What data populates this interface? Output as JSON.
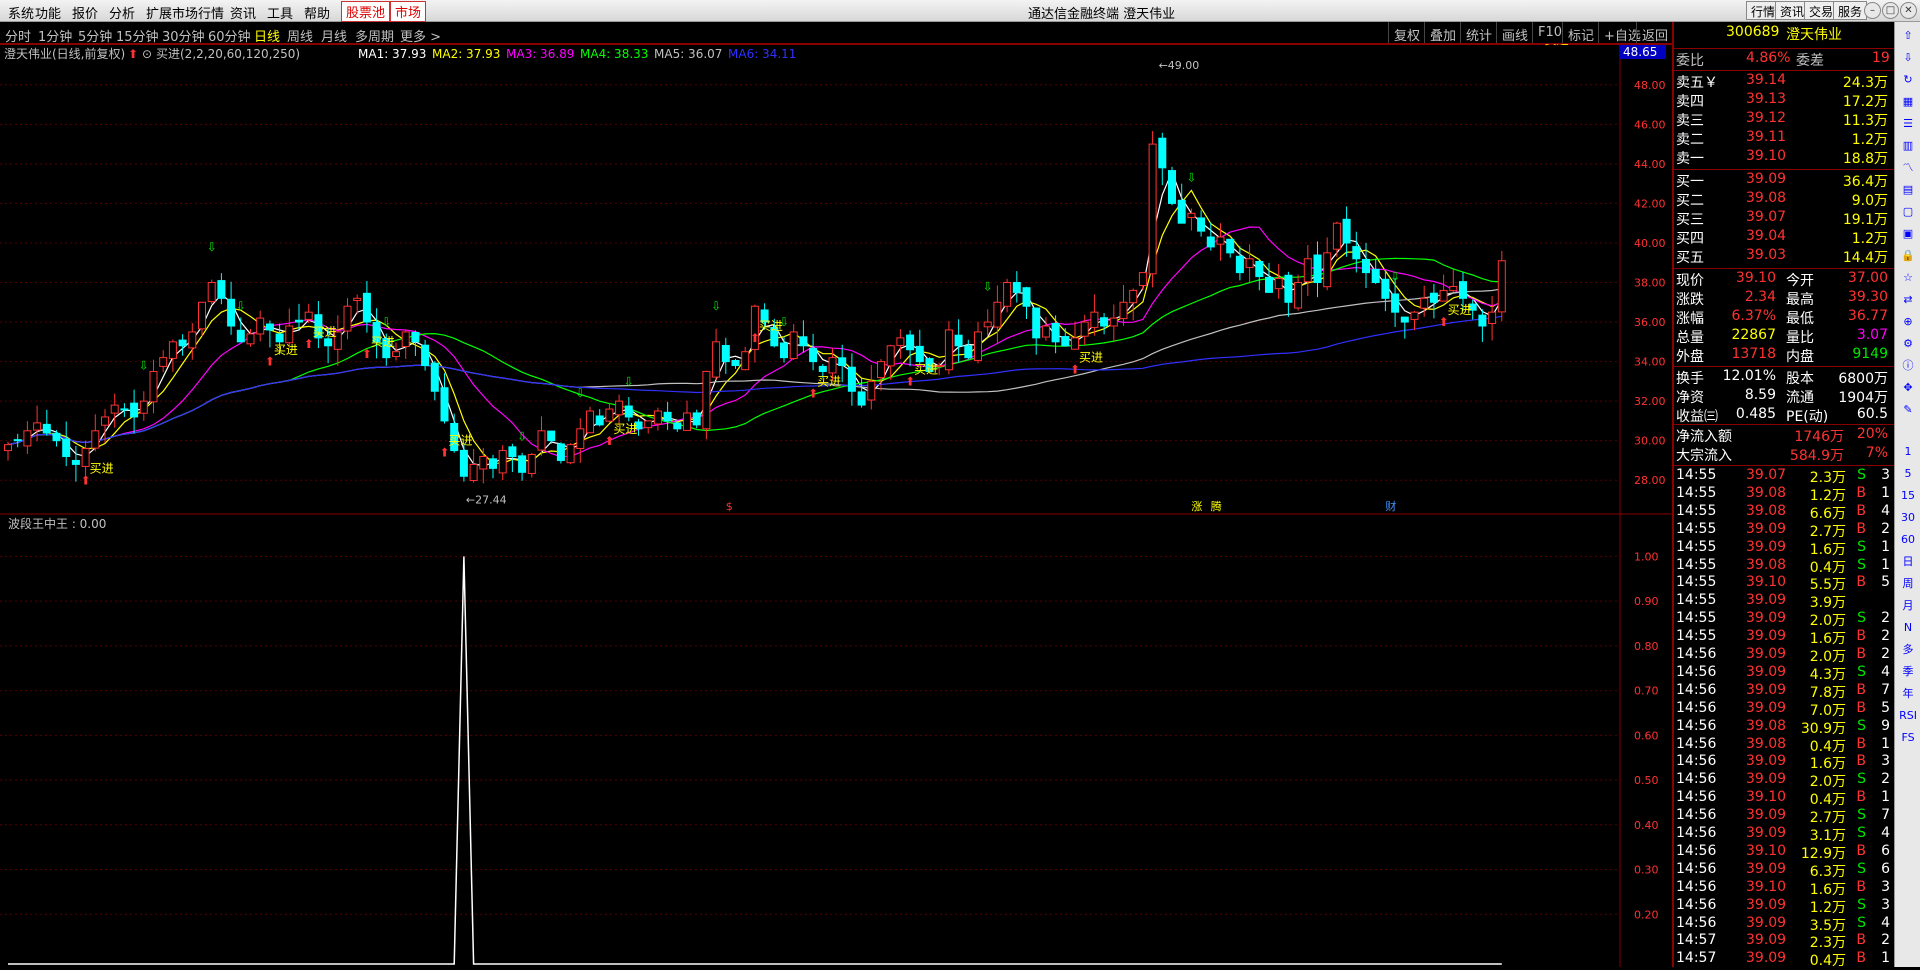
{
  "menu": [
    "系统",
    "功能",
    "报价",
    "分析",
    "扩展市场行情",
    "资讯",
    "工具",
    "帮助",
    "股票池",
    "市场"
  ],
  "window_title": "通达信金融终端  澄天伟业",
  "top_right_buttons": [
    "行情",
    "资讯",
    "交易",
    "服务"
  ],
  "period_tabs": [
    "分时",
    "1分钟",
    "5分钟",
    "15分钟",
    "30分钟",
    "60分钟",
    "日线",
    "周线",
    "月线",
    "多周期",
    "更多 >"
  ],
  "active_period": "日线",
  "chart_toolbar": [
    "复权",
    "叠加",
    "统计",
    "画线",
    "F10",
    "标记",
    "+自选",
    "返回"
  ],
  "main_chart": {
    "stock_label": "澄天伟业(日线,前复权)",
    "indicator_name": "买进(2,2,20,60,120,250)",
    "ma": [
      {
        "label": "MA1: 37.93",
        "color": "#ffffff"
      },
      {
        "label": "MA2: 37.93",
        "color": "#ffff00"
      },
      {
        "label": "MA3: 36.89",
        "color": "#ff00ff"
      },
      {
        "label": "MA4: 38.33",
        "color": "#00ff00"
      },
      {
        "label": "MA5: 36.07",
        "color": "#c0c0c0"
      },
      {
        "label": "MA6: 34.11",
        "color": "#3030ff"
      }
    ],
    "y_ticks": [
      "48.00",
      "46.00",
      "44.00",
      "42.00",
      "40.00",
      "38.00",
      "36.00",
      "34.00",
      "32.00",
      "30.00",
      "28.00"
    ],
    "top_price_tag": "48.65",
    "high_label": "49.00",
    "low_label": "27.44",
    "buy_label": "买进",
    "event_marks": [
      "$",
      "涨",
      "腾",
      "财"
    ]
  },
  "sub_chart": {
    "label": "波段王中王 : 0.00",
    "y_ticks": [
      "1.00",
      "0.90",
      "0.80",
      "0.70",
      "0.60",
      "0.50",
      "0.40",
      "0.30",
      "0.20"
    ]
  },
  "quote": {
    "code": "300689",
    "name": "澄天伟业",
    "weibi_label": "委比",
    "weibi": "4.86%",
    "weicha_label": "委差",
    "weicha": "19",
    "asks": [
      {
        "label": "卖五￥",
        "price": "39.14",
        "vol": "24.3万"
      },
      {
        "label": "卖四",
        "price": "39.13",
        "vol": "17.2万"
      },
      {
        "label": "卖三",
        "price": "39.12",
        "vol": "11.3万"
      },
      {
        "label": "卖二",
        "price": "39.11",
        "vol": "1.2万"
      },
      {
        "label": "卖一",
        "price": "39.10",
        "vol": "18.8万"
      }
    ],
    "bids": [
      {
        "label": "买一",
        "price": "39.09",
        "vol": "36.4万"
      },
      {
        "label": "买二",
        "price": "39.08",
        "vol": "9.0万"
      },
      {
        "label": "买三",
        "price": "39.07",
        "vol": "19.1万"
      },
      {
        "label": "买四",
        "price": "39.04",
        "vol": "1.2万"
      },
      {
        "label": "买五",
        "price": "39.03",
        "vol": "14.4万"
      }
    ],
    "stats": [
      {
        "l1": "现价",
        "v1": "39.10",
        "c1": "red",
        "l2": "今开",
        "v2": "37.00",
        "c2": "red"
      },
      {
        "l1": "涨跌",
        "v1": "2.34",
        "c1": "red",
        "l2": "最高",
        "v2": "39.30",
        "c2": "red"
      },
      {
        "l1": "涨幅",
        "v1": "6.37%",
        "c1": "red",
        "l2": "最低",
        "v2": "36.77",
        "c2": "red"
      },
      {
        "l1": "总量",
        "v1": "22867",
        "c1": "yel",
        "l2": "量比",
        "v2": "3.07",
        "c2": "mag"
      },
      {
        "l1": "外盘",
        "v1": "13718",
        "c1": "red",
        "l2": "内盘",
        "v2": "9149",
        "c2": "grn"
      }
    ],
    "stats2": [
      {
        "l1": "换手",
        "v1": "12.01%",
        "l2": "股本",
        "v2": "6800万"
      },
      {
        "l1": "净资",
        "v1": "8.59",
        "l2": "流通",
        "v2": "1904万"
      },
      {
        "l1": "收益㈢",
        "v1": "0.485",
        "l2": "PE(动)",
        "v2": "60.5"
      }
    ],
    "flows": [
      {
        "label": "净流入额",
        "value": "1746万",
        "pct": "20%"
      },
      {
        "label": "大宗流入",
        "value": "584.9万",
        "pct": "7%"
      }
    ],
    "ticks": [
      [
        "14:55",
        "39.07",
        "2.3万",
        "S",
        "3"
      ],
      [
        "14:55",
        "39.08",
        "1.2万",
        "B",
        "1"
      ],
      [
        "14:55",
        "39.08",
        "6.6万",
        "B",
        "4"
      ],
      [
        "14:55",
        "39.09",
        "2.7万",
        "B",
        "2"
      ],
      [
        "14:55",
        "39.09",
        "1.6万",
        "S",
        "1"
      ],
      [
        "14:55",
        "39.08",
        "0.4万",
        "S",
        "1"
      ],
      [
        "14:55",
        "39.10",
        "5.5万",
        "B",
        "5"
      ],
      [
        "14:55",
        "39.09",
        "3.9万",
        "",
        ""
      ],
      [
        "14:55",
        "39.09",
        "2.0万",
        "S",
        "2"
      ],
      [
        "14:55",
        "39.09",
        "1.6万",
        "B",
        "2"
      ],
      [
        "14:56",
        "39.09",
        "2.0万",
        "B",
        "2"
      ],
      [
        "14:56",
        "39.09",
        "4.3万",
        "S",
        "4"
      ],
      [
        "14:56",
        "39.09",
        "7.8万",
        "B",
        "7"
      ],
      [
        "14:56",
        "39.09",
        "7.0万",
        "B",
        "5"
      ],
      [
        "14:56",
        "39.08",
        "30.9万",
        "S",
        "9"
      ],
      [
        "14:56",
        "39.08",
        "0.4万",
        "B",
        "1"
      ],
      [
        "14:56",
        "39.09",
        "1.6万",
        "B",
        "3"
      ],
      [
        "14:56",
        "39.09",
        "2.0万",
        "S",
        "2"
      ],
      [
        "14:56",
        "39.10",
        "0.4万",
        "B",
        "1"
      ],
      [
        "14:56",
        "39.09",
        "2.7万",
        "S",
        "7"
      ],
      [
        "14:56",
        "39.09",
        "3.1万",
        "S",
        "4"
      ],
      [
        "14:56",
        "39.10",
        "12.9万",
        "B",
        "6"
      ],
      [
        "14:56",
        "39.09",
        "6.3万",
        "S",
        "6"
      ],
      [
        "14:56",
        "39.10",
        "1.6万",
        "B",
        "3"
      ],
      [
        "14:56",
        "39.09",
        "1.2万",
        "S",
        "3"
      ],
      [
        "14:56",
        "39.09",
        "3.5万",
        "S",
        "4"
      ],
      [
        "14:57",
        "39.09",
        "2.3万",
        "B",
        "2"
      ],
      [
        "14:57",
        "39.09",
        "0.4万",
        "B",
        "1"
      ]
    ]
  },
  "side_toolbar": [
    "1",
    "5",
    "15",
    "30",
    "60",
    "日",
    "周",
    "月",
    "N",
    "多",
    "季",
    "年",
    "RSI",
    "FS"
  ],
  "chart_data": {
    "type": "candlestick",
    "ylim": [
      27,
      49
    ],
    "closes": [
      29.8,
      30.0,
      30.5,
      30.9,
      30.4,
      30.0,
      29.2,
      28.8,
      29.6,
      30.5,
      31.2,
      31.8,
      31.6,
      31.2,
      32.0,
      33.5,
      34.2,
      35.0,
      34.8,
      35.5,
      37.0,
      38.0,
      37.2,
      35.8,
      35.0,
      35.4,
      36.2,
      35.6,
      35.0,
      35.8,
      36.0,
      36.5,
      35.2,
      34.8,
      35.5,
      36.8,
      37.2,
      36.0,
      35.0,
      34.2,
      34.5,
      35.5,
      35.0,
      33.8,
      32.5,
      31.0,
      29.5,
      28.2,
      28.8,
      29.2,
      28.6,
      29.5,
      29.2,
      28.4,
      29.3,
      30.5,
      30.0,
      29.0,
      29.8,
      30.6,
      31.5,
      30.8,
      31.6,
      32.0,
      31.2,
      30.6,
      31.0,
      31.5,
      31.0,
      30.6,
      31.4,
      30.8,
      33.5,
      35.0,
      34.0,
      33.8,
      34.5,
      36.8,
      36.0,
      34.8,
      34.2,
      35.5,
      34.8,
      34.0,
      33.5,
      34.2,
      33.8,
      32.5,
      31.8,
      33.0,
      34.0,
      34.8,
      35.2,
      34.6,
      34.0,
      33.5,
      33.8,
      35.6,
      34.8,
      34.2,
      35.5,
      36.0,
      37.0,
      38.0,
      37.5,
      36.8,
      35.2,
      35.8,
      35.0,
      34.8,
      35.2,
      36.0,
      36.5,
      35.8,
      36.2,
      37.0,
      37.6,
      38.5,
      45.0,
      43.8,
      42.0,
      41.0,
      41.5,
      40.6,
      39.8,
      40.3,
      39.5,
      38.5,
      39.2,
      38.3,
      37.5,
      38.2,
      37.0,
      38.0,
      39.2,
      38.0,
      39.5,
      41.0,
      40.0,
      39.2,
      38.5,
      38.0,
      37.2,
      36.5,
      36.0,
      36.5,
      37.2,
      37.0,
      37.6,
      37.8,
      37.2,
      36.6,
      35.8,
      36.5,
      39.1
    ],
    "ma_lines": [
      "MA1",
      "MA2",
      "MA3",
      "MA4",
      "MA5",
      "MA6"
    ],
    "sub_indicator": {
      "name": "波段王中王",
      "spike_index": 47,
      "spike_value": 1.0,
      "ylim": [
        0.1,
        1.05
      ]
    }
  }
}
